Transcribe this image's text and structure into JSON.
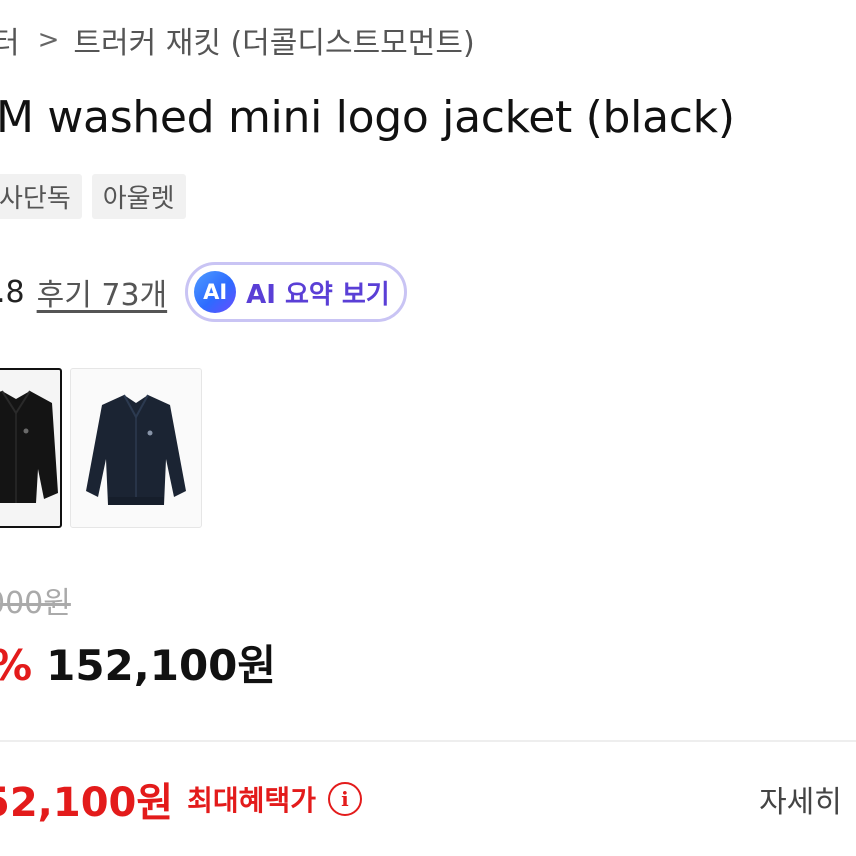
{
  "breadcrumb": {
    "prev_partial": "터",
    "separator": ">",
    "current": "트러커 재킷 (더콜디스트모먼트)"
  },
  "product": {
    "title": "M washed mini logo jacket (black)",
    "tags": [
      "사단독",
      "아울렛"
    ]
  },
  "rating": {
    "value_partial": ".8",
    "review_link": "후기 73개"
  },
  "ai_summary": {
    "badge": "AI",
    "label": "AI 요약 보기"
  },
  "thumbnails": [
    {
      "name": "black jacket",
      "color": "#141414",
      "selected": true
    },
    {
      "name": "navy jacket",
      "color": "#1b2433",
      "selected": false
    }
  ],
  "pricing": {
    "original_partial": "000원",
    "discount_partial": "%",
    "sale_price": "152,100원"
  },
  "benefit": {
    "price_partial": "52,100원",
    "label": "최대혜택가",
    "info_icon": "i",
    "detail_link": "자세히",
    "detail_arrow": "⌄"
  },
  "colors": {
    "accent_red": "#e31b1b",
    "ai_purple": "#5a3fd6",
    "ai_border": "#c9c4f4"
  }
}
